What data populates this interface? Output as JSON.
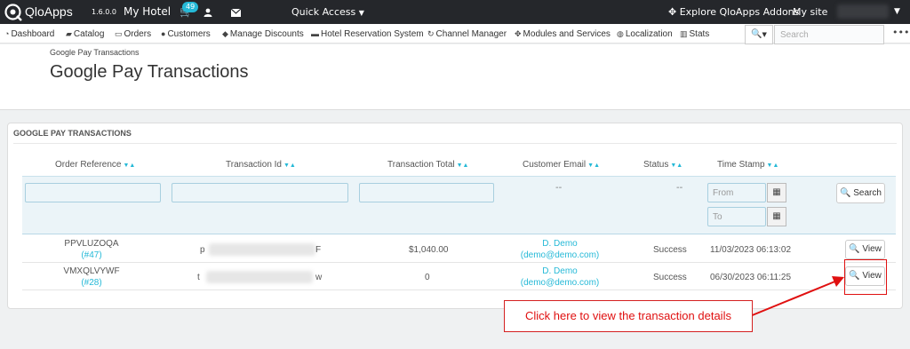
{
  "topbar": {
    "brand": "QloApps",
    "version": "1.6.0.0",
    "shop_name": "My Hotel",
    "cart_badge": "49",
    "quick_access": "Quick Access",
    "explore": "Explore QloApps Addons",
    "my_site": "My site"
  },
  "nav": {
    "items": [
      {
        "label": "Dashboard",
        "icon": "dashboard-icon"
      },
      {
        "label": "Catalog",
        "icon": "book-icon"
      },
      {
        "label": "Orders",
        "icon": "credit-card-icon"
      },
      {
        "label": "Customers",
        "icon": "users-icon"
      },
      {
        "label": "Manage Discounts",
        "icon": "tag-icon"
      },
      {
        "label": "Hotel Reservation System",
        "icon": "bed-icon"
      },
      {
        "label": "Channel Manager",
        "icon": "refresh-icon"
      },
      {
        "label": "Modules and Services",
        "icon": "puzzle-icon"
      },
      {
        "label": "Localization",
        "icon": "globe-icon"
      },
      {
        "label": "Stats",
        "icon": "bar-chart-icon"
      }
    ],
    "search_placeholder": "Search"
  },
  "header": {
    "breadcrumb": "Google Pay Transactions",
    "title": "Google Pay Transactions"
  },
  "panel": {
    "heading": "Google Pay Transactions",
    "columns": [
      "Order Reference",
      "Transaction Id",
      "Transaction Total",
      "Customer Email",
      "Status",
      "Time Stamp"
    ],
    "filters": {
      "email": "--",
      "status": "--",
      "from_placeholder": "From",
      "to_placeholder": "To",
      "search_label": "Search"
    },
    "rows": [
      {
        "reference": "PPVLUZOQA",
        "order_id": "(#47)",
        "txn_prefix": "p",
        "txn_suffix": "F",
        "total": "$1,040.00",
        "customer_name": "D. Demo",
        "customer_email": "(demo@demo.com)",
        "status": "Success",
        "timestamp": "11/03/2023 06:13:02",
        "view_label": "View"
      },
      {
        "reference": "VMXQLVYWF",
        "order_id": "(#28)",
        "txn_prefix": "t",
        "txn_suffix": "w",
        "total": "0",
        "customer_name": "D. Demo",
        "customer_email": "(demo@demo.com)",
        "status": "Success",
        "timestamp": "06/30/2023 06:11:25",
        "view_label": "View"
      }
    ]
  },
  "annotation": {
    "callout": "Click here to view the transaction details",
    "color": "#e01010"
  },
  "colors": {
    "topbar": "#25272b",
    "accent": "#25b9d7"
  }
}
